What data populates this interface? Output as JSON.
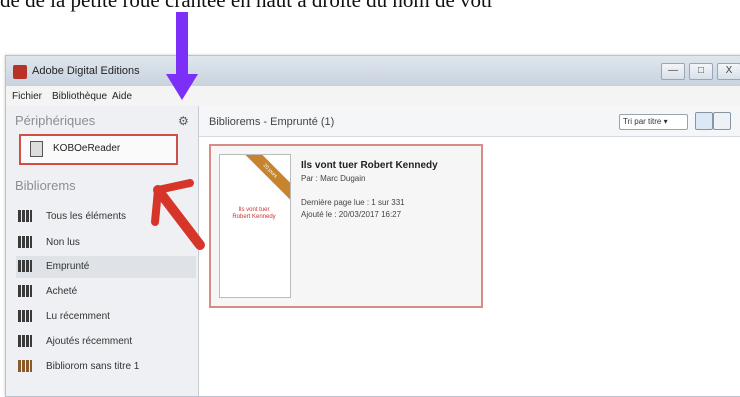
{
  "instruction": "de de la petite roue crantée en haut à droite du nom de votr",
  "window": {
    "title": "Adobe Digital Editions",
    "controls": [
      "—",
      "□",
      "X"
    ]
  },
  "menu": [
    "Fichier",
    "Bibliothèque",
    "Aide"
  ],
  "sidebar": {
    "devices_header": "Périphériques",
    "device_name": "KOBOeReader",
    "library_header": "Bibliorems",
    "items": [
      {
        "label": "Tous les éléments"
      },
      {
        "label": "Non lus"
      },
      {
        "label": "Emprunté"
      },
      {
        "label": "Acheté"
      },
      {
        "label": "Lu récemment"
      },
      {
        "label": "Ajoutés récemment"
      },
      {
        "label": "Bibliorom sans titre 1"
      }
    ]
  },
  "main": {
    "title": "Bibliorems - Emprunté (1)",
    "sort_label": "Tri par titre",
    "book": {
      "title": "Ils vont tuer Robert Kennedy",
      "author": "Par : Marc Dugain",
      "last_page": "Dernière page lue : 1 sur 331",
      "added": "Ajouté le : 20/03/2017 16:27",
      "cover_title": "Ils vont tuer Robert Kennedy",
      "ribbon": "20 jours"
    }
  },
  "colors": {
    "annotation_red": "#d8352a",
    "annotation_purple": "#7b2ff7"
  }
}
